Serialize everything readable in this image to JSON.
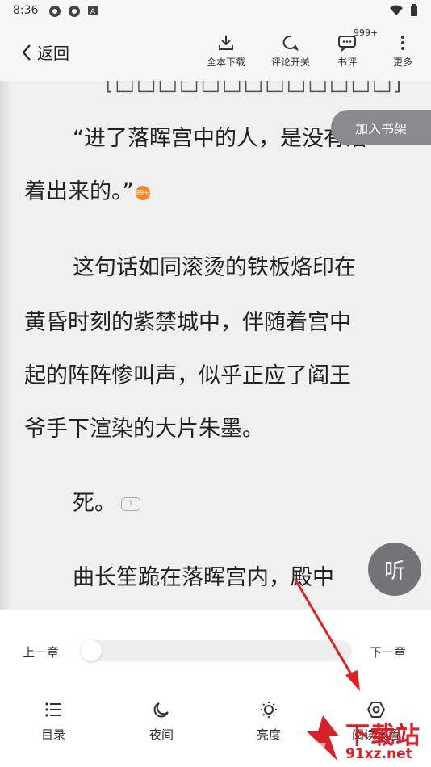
{
  "status_bar": {
    "time": "8:36"
  },
  "toolbar": {
    "back_label": "返回",
    "download_label": "全本下载",
    "comment_switch_label": "评论开关",
    "review_label": "书评",
    "review_badge": "999+",
    "more_label": "更多"
  },
  "reader": {
    "add_shelf_label": "加入书架",
    "cut_line": "[□□□□□□□□□□□□□]",
    "lines": [
      "“进了落晖宫中的人，是没有活",
      "着出来的。”",
      "这句话如同滚烫的铁板烙印在",
      "黄昏时刻的紫禁城中，伴随着宫中",
      "起的阵阵惨叫声，似乎正应了阎王",
      "爷手下渲染的大片朱墨。",
      "死。",
      "曲长笙跪在落晖宫内，殿中"
    ],
    "hot_badge": "99+",
    "comment_count": "1",
    "listen_label": "听"
  },
  "bottom_bar": {
    "prev_chapter": "上一章",
    "next_chapter": "下一章",
    "progress": 0,
    "nav": [
      {
        "label": "目录",
        "icon": "list-icon"
      },
      {
        "label": "夜间",
        "icon": "moon-icon"
      },
      {
        "label": "亮度",
        "icon": "brightness-icon"
      },
      {
        "label": "阅读设置",
        "icon": "settings-icon"
      }
    ]
  },
  "watermark": {
    "top_text": "下载站",
    "bottom_text": "91xz.net"
  },
  "colors": {
    "accent_red": "#d8202a",
    "panel_bg": "#f0f0f0",
    "button_gray": "#727477"
  }
}
